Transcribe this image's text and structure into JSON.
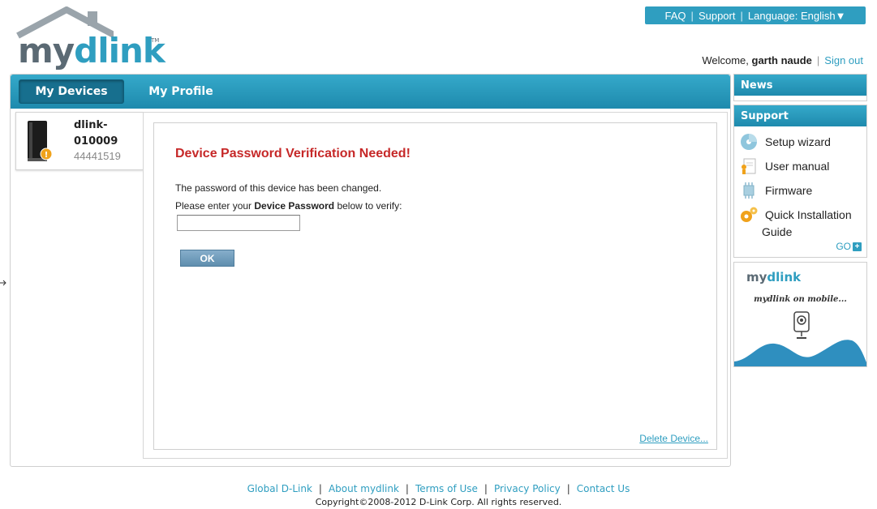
{
  "brand": {
    "my": "my",
    "dlink": "dlink",
    "tm": "TM"
  },
  "topbar": {
    "faq": "FAQ",
    "support": "Support",
    "language": "Language: English▼"
  },
  "welcome": {
    "prefix": "Welcome, ",
    "user": "garth naude",
    "signout": "Sign out"
  },
  "nav": {
    "tabs": [
      {
        "label": "My Devices"
      },
      {
        "label": "My Profile"
      }
    ]
  },
  "device": {
    "name": "dlink-010009",
    "id": "44441519",
    "status_icon": "warning-icon"
  },
  "verification": {
    "title": "Device Password Verification Needed!",
    "line1": "The password of this device has been changed.",
    "line2_pre": "Please enter your ",
    "line2_bold": "Device Password",
    "line2_post": " below to verify:",
    "password_value": "",
    "ok_label": "OK",
    "delete_label": "Delete Device..."
  },
  "sidebar": {
    "news_header": "News",
    "support_header": "Support",
    "support_items": [
      {
        "label": "Setup wizard",
        "icon": "setup-wizard-icon"
      },
      {
        "label": "User manual",
        "icon": "user-manual-icon"
      },
      {
        "label": "Firmware",
        "icon": "firmware-chip-icon"
      },
      {
        "label": "Quick Installation",
        "label2": "Guide",
        "icon": "gears-icon"
      }
    ],
    "go_label": "GO",
    "promo": {
      "my": "my",
      "dlink": "dlink",
      "tagline": "mydlink on mobile..."
    }
  },
  "footer": {
    "links": [
      "Global D-Link",
      "About mydlink",
      "Terms of Use",
      "Privacy Policy",
      "Contact Us"
    ],
    "copyright": "Copyright©2008-2012 D-Link Corp. All rights reserved."
  },
  "colors": {
    "accent": "#2f9ec0",
    "title_red": "#c62828",
    "nav_active": "#176f8e"
  }
}
